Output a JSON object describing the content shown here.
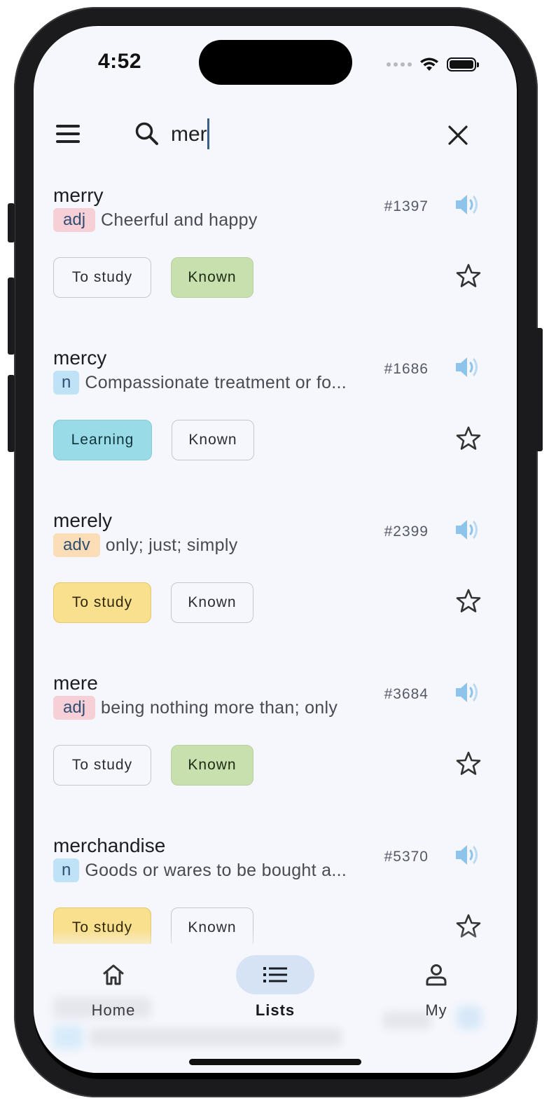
{
  "status": {
    "time": "4:52"
  },
  "search": {
    "value": "mer",
    "placeholder": ""
  },
  "words": [
    {
      "word": "merry",
      "pos": "adj",
      "definition": "Cheerful and happy",
      "rank": "#1397",
      "chip1": "To study",
      "chip2": "Known",
      "state": "known"
    },
    {
      "word": "mercy",
      "pos": "n",
      "definition": "Compassionate treatment or fo...",
      "rank": "#1686",
      "chip1": "Learning",
      "chip2": "Known",
      "state": "learning"
    },
    {
      "word": "merely",
      "pos": "adv",
      "definition": "only; just; simply",
      "rank": "#2399",
      "chip1": "To study",
      "chip2": "Known",
      "state": "to-study"
    },
    {
      "word": "mere",
      "pos": "adj",
      "definition": "being nothing more than; only",
      "rank": "#3684",
      "chip1": "To study",
      "chip2": "Known",
      "state": "known"
    },
    {
      "word": "merchandise",
      "pos": "n",
      "definition": "Goods or wares to be bought a...",
      "rank": "#5370",
      "chip1": "To study",
      "chip2": "Known",
      "state": "to-study"
    }
  ],
  "nav": {
    "items": [
      {
        "label": "Home",
        "icon": "home-icon",
        "active": false
      },
      {
        "label": "Lists",
        "icon": "list-icon",
        "active": true
      },
      {
        "label": "My",
        "icon": "person-icon",
        "active": false
      }
    ]
  },
  "colors": {
    "background": "#f6f7fd",
    "known": "#c8e0ae",
    "learning": "#9adbe8",
    "to_study": "#f9e08f",
    "speaker": "#8cc4ec",
    "nav_active_pill": "#d6e3f4"
  }
}
